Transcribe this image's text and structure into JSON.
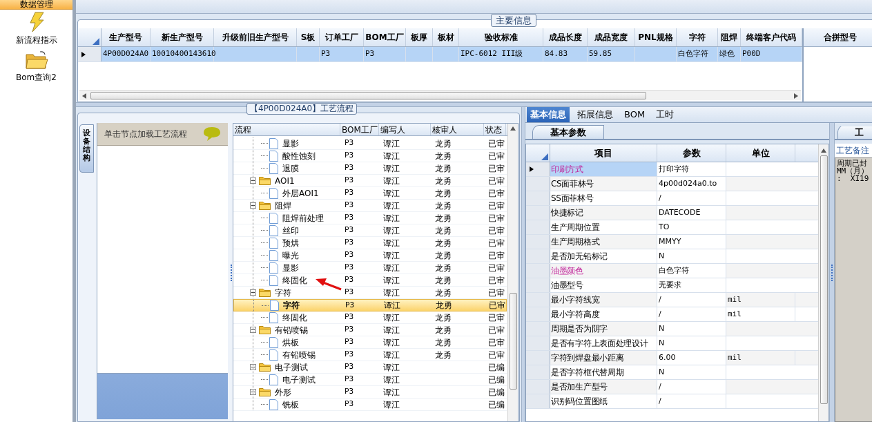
{
  "sidebar": {
    "header": "数据管理",
    "items": [
      {
        "label": "新流程指示",
        "kind": "bolt"
      },
      {
        "label": "Bom查询2",
        "kind": "folder"
      }
    ]
  },
  "main_info": {
    "title": "主要信息",
    "columns": [
      "生产型号",
      "新生产型号",
      "升级前旧生产型号",
      "S板",
      "订单工厂",
      "BOM工厂",
      "板厚",
      "板材",
      "验收标准",
      "成品长度",
      "成品宽度",
      "PNL规格",
      "字符",
      "阻焊",
      "终端客户代码"
    ],
    "rows": [
      {
        "selected": true,
        "cells": [
          "4P00D024A0",
          "10010400143610",
          null,
          null,
          "P3",
          "P3",
          null,
          null,
          "IPC-6012 III级",
          "84.83",
          "59.85",
          null,
          "白色字符",
          "绿色",
          "P00D"
        ]
      }
    ],
    "side_column": "合拼型号"
  },
  "process": {
    "title": "【4P00D024A0】工艺流程",
    "side_tab": "设备结构",
    "hint": "单击节点加载工艺流程",
    "columns": [
      "流程",
      "BOM工厂",
      "编写人",
      "核审人",
      "状态"
    ],
    "tree": [
      {
        "children": [
          {
            "kind": "file",
            "label": "显影",
            "bom": "P3",
            "writer": "谭江",
            "reviewer": "龙勇",
            "status": "已审",
            "selected": false
          },
          {
            "kind": "file",
            "label": "酸性蚀刻",
            "bom": "P3",
            "writer": "谭江",
            "reviewer": "龙勇",
            "status": "已审",
            "selected": false
          },
          {
            "kind": "file",
            "label": "退膜",
            "bom": "P3",
            "writer": "谭江",
            "reviewer": "龙勇",
            "status": "已审",
            "selected": false
          }
        ]
      },
      {
        "kind": "folder",
        "expanded": true,
        "label": "AOI1",
        "bom": "P3",
        "writer": "谭江",
        "reviewer": "龙勇",
        "status": "已审",
        "selected": false,
        "children": [
          {
            "kind": "file",
            "label": "外层AOI1",
            "bom": "P3",
            "writer": "谭江",
            "reviewer": "龙勇",
            "status": "已审",
            "selected": false
          }
        ]
      },
      {
        "kind": "folder",
        "expanded": true,
        "label": "阻焊",
        "bom": "P3",
        "writer": "谭江",
        "reviewer": "龙勇",
        "status": "已审",
        "selected": false,
        "children": [
          {
            "kind": "file",
            "label": "阻焊前处理",
            "bom": "P3",
            "writer": "谭江",
            "reviewer": "龙勇",
            "status": "已审",
            "selected": false
          },
          {
            "kind": "file",
            "label": "丝印",
            "bom": "P3",
            "writer": "谭江",
            "reviewer": "龙勇",
            "status": "已审",
            "selected": false
          },
          {
            "kind": "file",
            "label": "预烘",
            "bom": "P3",
            "writer": "谭江",
            "reviewer": "龙勇",
            "status": "已审",
            "selected": false
          },
          {
            "kind": "file",
            "label": "曝光",
            "bom": "P3",
            "writer": "谭江",
            "reviewer": "龙勇",
            "status": "已审",
            "selected": false
          },
          {
            "kind": "file",
            "label": "显影",
            "bom": "P3",
            "writer": "谭江",
            "reviewer": "龙勇",
            "status": "已审",
            "selected": false
          },
          {
            "kind": "file",
            "label": "终固化",
            "bom": "P3",
            "writer": "谭江",
            "reviewer": "龙勇",
            "status": "已审",
            "selected": false
          }
        ]
      },
      {
        "kind": "folder",
        "expanded": true,
        "label": "字符",
        "bom": "P3",
        "writer": "谭江",
        "reviewer": "龙勇",
        "status": "已审",
        "selected": false,
        "children": [
          {
            "kind": "file",
            "label": "字符",
            "bom": "P3",
            "writer": "谭江",
            "reviewer": "龙勇",
            "status": "已审",
            "selected": true
          },
          {
            "kind": "file",
            "label": "终固化",
            "bom": "P3",
            "writer": "谭江",
            "reviewer": "龙勇",
            "status": "已审",
            "selected": false
          }
        ]
      },
      {
        "kind": "folder",
        "expanded": true,
        "label": "有铅喷锡",
        "bom": "P3",
        "writer": "谭江",
        "reviewer": "龙勇",
        "status": "已审",
        "selected": false,
        "children": [
          {
            "kind": "file",
            "label": "烘板",
            "bom": "P3",
            "writer": "谭江",
            "reviewer": "龙勇",
            "status": "已审",
            "selected": false
          },
          {
            "kind": "file",
            "label": "有铅喷锡",
            "bom": "P3",
            "writer": "谭江",
            "reviewer": "龙勇",
            "status": "已审",
            "selected": false
          }
        ]
      },
      {
        "kind": "folder",
        "expanded": true,
        "label": "电子测试",
        "bom": "P3",
        "writer": "谭江",
        "status": "已编",
        "selected": false,
        "children": [
          {
            "kind": "file",
            "label": "电子测试",
            "bom": "P3",
            "writer": "谭江",
            "status": "已编",
            "selected": false
          }
        ]
      },
      {
        "kind": "folder",
        "expanded": true,
        "label": "外形",
        "bom": "P3",
        "writer": "谭江",
        "status": "已编",
        "selected": false,
        "children": [
          {
            "kind": "file",
            "label": "铣板",
            "bom": "P3",
            "writer": "谭江",
            "status": "已编",
            "selected": false
          }
        ]
      }
    ]
  },
  "detail": {
    "tabs": [
      {
        "label": "基本信息",
        "selected": true
      },
      {
        "label": "拓展信息",
        "selected": false
      },
      {
        "label": "BOM",
        "selected": false
      },
      {
        "label": "工时",
        "selected": false
      }
    ],
    "subtab": "基本参数",
    "columns": [
      "项目",
      "参数",
      "单位"
    ],
    "rows": [
      {
        "name": "印刷方式",
        "value": "打印字符",
        "emphasis": true,
        "selected": true
      },
      {
        "name": "CS面菲林号",
        "value": "4p00d024a0.to",
        "emphasis": false,
        "selected": false
      },
      {
        "name": "SS面菲林号",
        "value": "/",
        "emphasis": false,
        "selected": false
      },
      {
        "name": "快捷标记",
        "value": "DATECODE",
        "emphasis": false,
        "selected": false
      },
      {
        "name": "生产周期位置",
        "value": "TO",
        "emphasis": false,
        "selected": false
      },
      {
        "name": "生产周期格式",
        "value": "MMYY",
        "emphasis": false,
        "selected": false
      },
      {
        "name": "是否加无铅标记",
        "value": "N",
        "emphasis": false,
        "selected": false
      },
      {
        "name": "油墨颜色",
        "value": "白色字符",
        "emphasis": true,
        "selected": false
      },
      {
        "name": "油墨型号",
        "value": "无要求",
        "emphasis": false,
        "selected": false
      },
      {
        "name": "最小字符线宽",
        "value": "/",
        "unit": "mil",
        "emphasis": false,
        "selected": false
      },
      {
        "name": "最小字符高度",
        "value": "/",
        "unit": "mil",
        "emphasis": false,
        "selected": false
      },
      {
        "name": "周期是否为阴字",
        "value": "N",
        "emphasis": false,
        "selected": false
      },
      {
        "name": "是否有字符上表面处理设计",
        "value": "N",
        "emphasis": false,
        "selected": false
      },
      {
        "name": "字符到焊盘最小距离",
        "value": "6.00",
        "unit": "mil",
        "emphasis": false,
        "selected": false
      },
      {
        "name": "是否字符框代替周期",
        "value": "N",
        "emphasis": false,
        "selected": false
      },
      {
        "name": "是否加生产型号",
        "value": "/",
        "emphasis": false,
        "selected": false
      },
      {
        "name": "识别码位置图纸",
        "value": "/",
        "emphasis": false,
        "selected": false
      }
    ]
  },
  "notes": {
    "tab": "工",
    "header": "工艺备注",
    "lines": [
      "周期已封",
      "MM（月）",
      ":  XI19"
    ]
  }
}
